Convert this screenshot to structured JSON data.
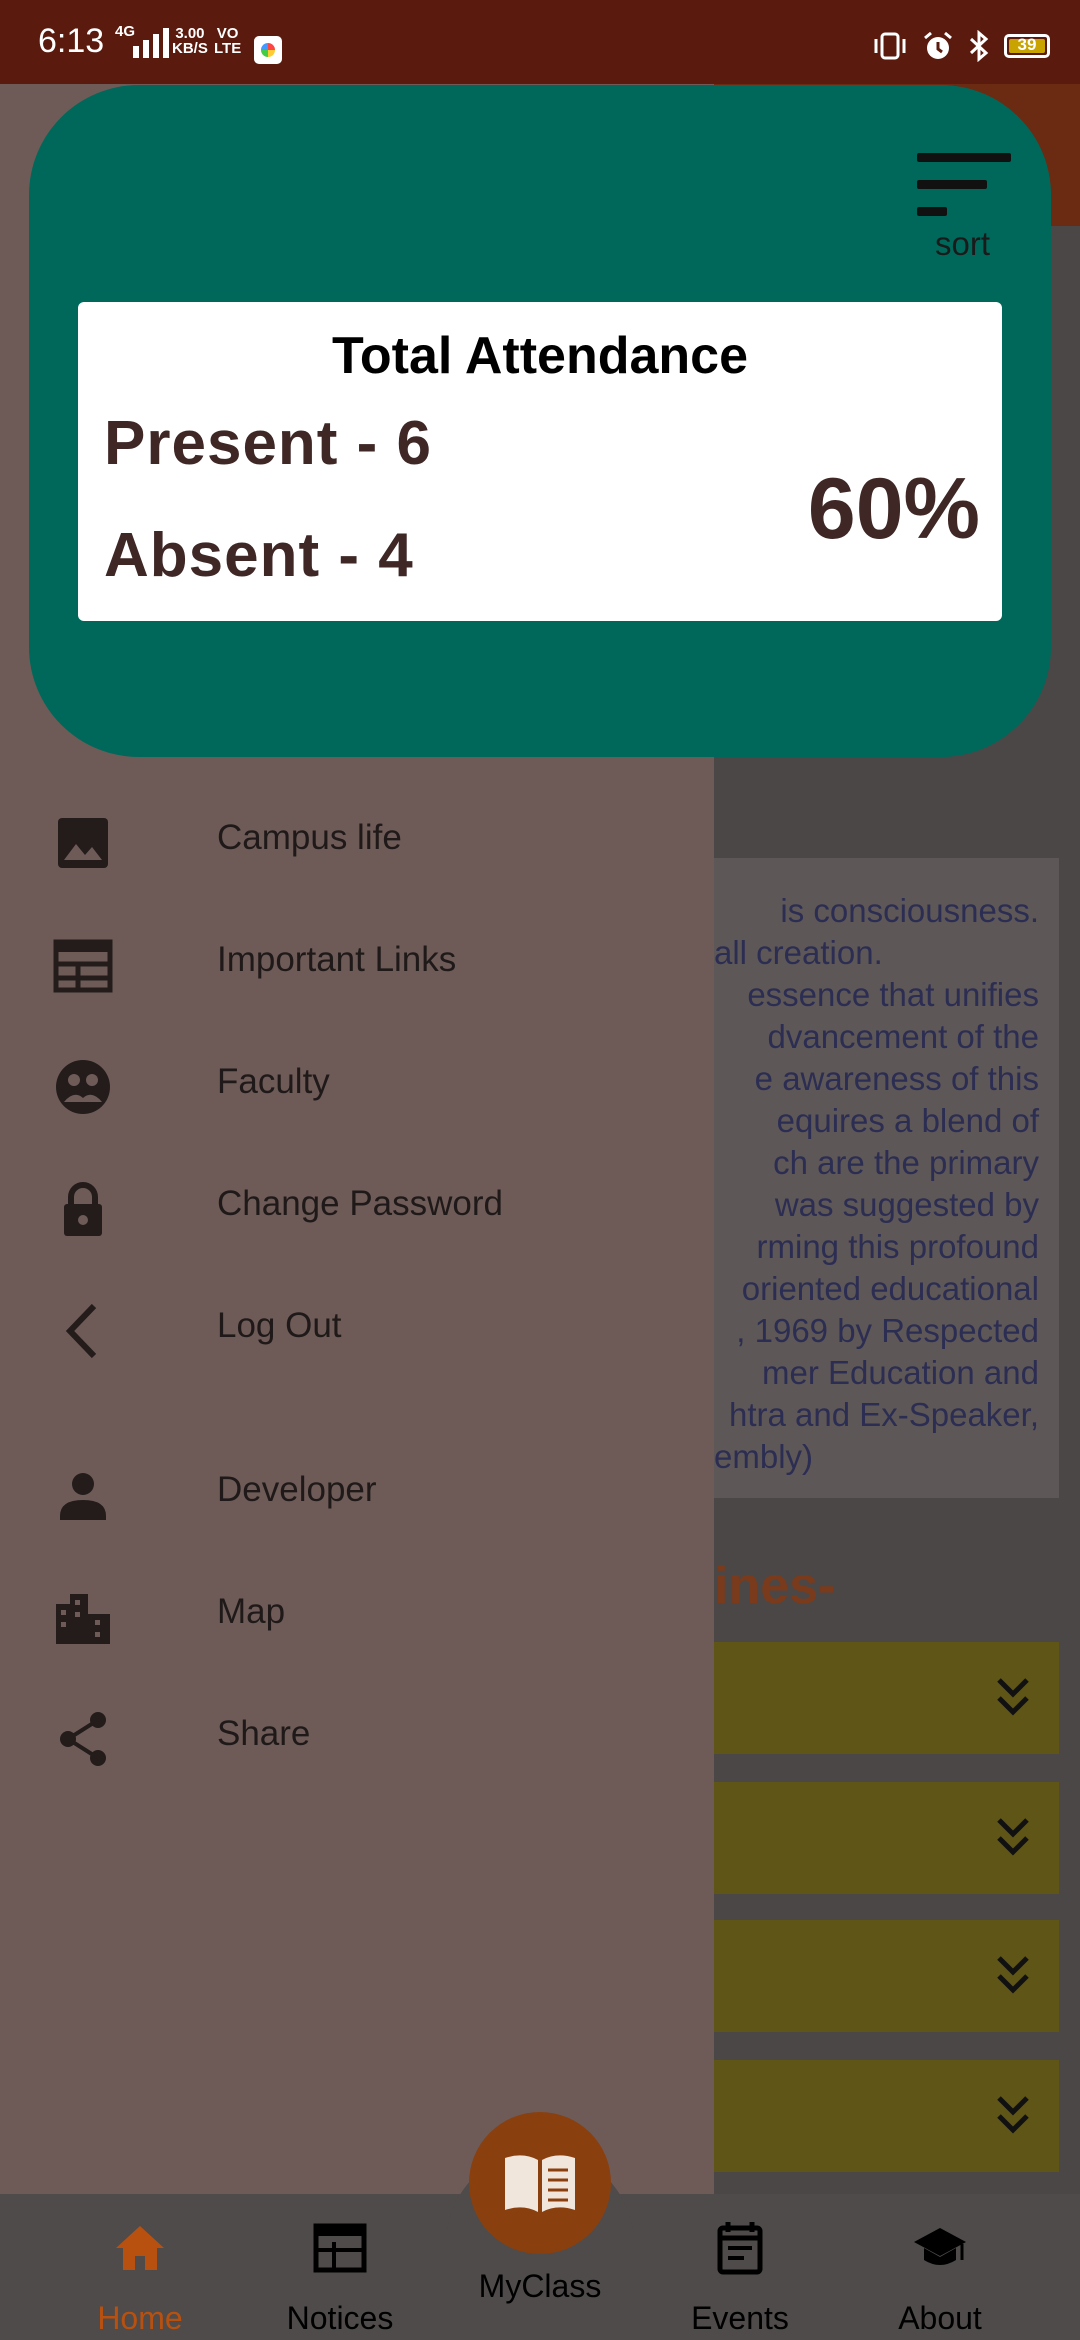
{
  "status_bar": {
    "time": "6:13",
    "network": "4G",
    "speed_value": "3.00",
    "speed_unit": "KB/S",
    "volte_top": "VO",
    "volte_bottom": "LTE",
    "battery": "39"
  },
  "attendance": {
    "sort_label": "sort",
    "title": "Total Attendance",
    "present": "Present - 6",
    "absent": "Absent - 4",
    "percentage": "60%"
  },
  "drawer": {
    "items": [
      {
        "label": "Campus life",
        "icon": "image-icon"
      },
      {
        "label": "Important Links",
        "icon": "calendar-grid-icon"
      },
      {
        "label": "Faculty",
        "icon": "faculty-icon"
      },
      {
        "label": "Change Password",
        "icon": "lock-icon"
      },
      {
        "label": "Log Out",
        "icon": "chevron-left-icon"
      },
      {
        "label": "Developer",
        "icon": "person-icon"
      },
      {
        "label": "Map",
        "icon": "city-icon"
      },
      {
        "label": "Share",
        "icon": "share-icon"
      }
    ]
  },
  "background": {
    "section_heading_tail": "-",
    "paragraph_lines": [
      "is consciousness.",
      "all creation.",
      "essence that unifies",
      "dvancement of the",
      "e awareness of this",
      "equires a blend of",
      "ch are the primary",
      "was suggested by",
      "rming this profound",
      "oriented educational",
      ", 1969 by Respected",
      "mer Education and",
      "htra and Ex-Speaker,",
      "embly)"
    ],
    "guidelines_heading_tail": "ines-"
  },
  "bottom_nav": {
    "items": [
      {
        "label": "Home",
        "icon": "home-icon",
        "active": true
      },
      {
        "label": "Notices",
        "icon": "newspaper-icon",
        "active": false
      },
      {
        "label": "Events",
        "icon": "event-icon",
        "active": false
      },
      {
        "label": "About",
        "icon": "graduation-cap-icon",
        "active": false
      }
    ],
    "center": {
      "label": "MyClass",
      "icon": "open-book-icon"
    }
  },
  "colors": {
    "status_bar": "#5a1a0e",
    "sheet": "#00685a",
    "drawer": "#6e5b57",
    "active_nav": "#b8510f",
    "fab": "#8a3f0e",
    "accordion": "#5f5517"
  }
}
